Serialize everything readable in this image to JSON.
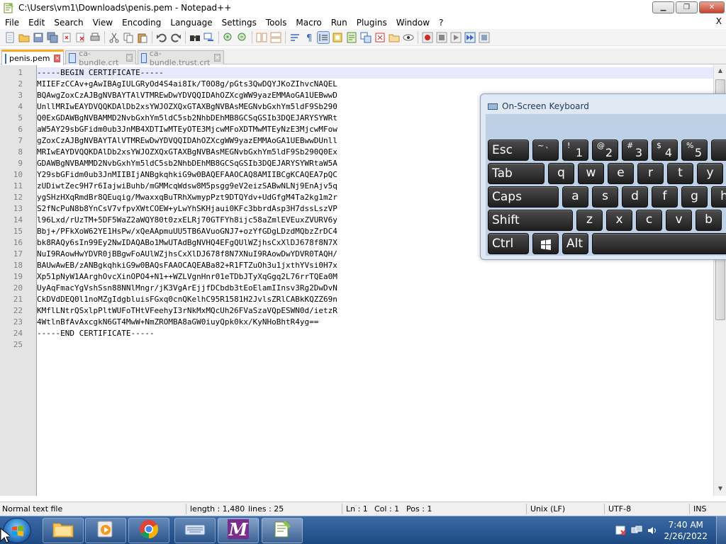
{
  "window": {
    "title": "C:\\Users\\vm1\\Downloads\\penis.pem - Notepad++",
    "minimize_label": "▁",
    "maximize_label": "❐",
    "close_label": "✕"
  },
  "menu": {
    "items": [
      "File",
      "Edit",
      "Search",
      "View",
      "Encoding",
      "Language",
      "Settings",
      "Tools",
      "Macro",
      "Run",
      "Plugins",
      "Window",
      "?"
    ],
    "close": "X"
  },
  "tabs": [
    {
      "label": "penis.pem",
      "active": true
    },
    {
      "label": "ca-bundle.crt",
      "active": false
    },
    {
      "label": "ca-bundle.trust.crt",
      "active": false
    }
  ],
  "editor": {
    "current_line": 1,
    "lines": [
      "-----BEGIN CERTIFICATE-----",
      "MIIEFzCCAv+gAwIBAgIULGRyOd4S4ai8Ik/T0O8g/pGts3QwDQYJKoZIhvcNAQEL",
      "BQAwgZoxCzAJBgNVBAYTAlVTMREwDwYDVQQIDAhOZXcgWW9yazEMMAoGA1UEBwwD",
      "UnllMRIwEAYDVQQKDAlDb2xsYWJOZXQxGTAXBgNVBAsMEGNvbGxhYm5ldF9Sb290",
      "Q0ExGDAWBgNVBAMMD2NvbGxhYm5ldC5sb2NhbDEhMB8GCSqGSIb3DQEJARYSYWRt",
      "aW5AY29sbGFidm0ub3JnMB4XDTIwMTEyOTE3MjcwMFoXDTMwMTEyNzE3MjcwMFow",
      "gZoxCzAJBgNVBAYTAlVTMREwDwYDVQQIDAhOZXcgWW9yazEMMAoGA1UEBwwDUnll",
      "MRIwEAYDVQQKDAlDb2xsYWJOZXQxGTAXBgNVBAsMEGNvbGxhYm5ldF9Sb290Q0Ex",
      "GDAWBgNVBAMMD2NvbGxhYm5ldC5sb2NhbDEhMB8GCSqGSIb3DQEJARYSYWRtaW5A",
      "Y29sbGFidm0ub3JnMIIBIjANBgkqhkiG9w0BAQEFAAOCAQ8AMIIBCgKCAQEA7pQC",
      "zUDiwtZec9H7r6IajwiBuhb/mGMMcqWdsw8M5psgg9eV2eizSABwNLNj9EnAjv5q",
      "ygSHzHXqRmdBr8QEuqig/MwaxxqBuTRhXwmypPzt9DTQYdv+UdGfgM4Ta2kg1m2r",
      "S2fNcPuN8b8YnCsV7vfpvXWtCOEW+yLwYhSKHjaui0KFc3bbrdAsp3H7dssLszVP",
      "l96Lxd/rUzTM+5DF5WaZ2aWQY80t0zxELRj70GTFYh8ijc58aZmlEVEuxZVURV6y",
      "Bbj+/PFkXoW62YE1HsPw/xQeAApmuUU5TB6AVuoGNJ7+ozYfGDgLDzdMQbzZrDC4",
      "bk8RAQy6sIn99Ey2NwIDAQABo1MwUTAdBgNVHQ4EFgQUlWZjhsCxXlDJ678f8N7X",
      "NuI9RAowHwYDVR0jBBgwFoAUlWZjhsCxXlDJ678f8N7XNuI9RAowDwYDVR0TAQH/",
      "BAUwAwEB/zANBgkqhkiG9w0BAQsFAAOCAQEABa82+R1FTZuOh3u1jxthYVsi0H7x",
      "Xp51pNyW1AArghOvcXinOPO4+N1++WZLVgnHnr01eTDbJTyXqGgq2L76rrTQEa0M",
      "UyAqFmacYgVshSsn88NNlMngr/jK3VgArEjjfDCbdb3tEoElamIInsv3Rg2DwDvN",
      "CkDVdDEQ0l1noMZgIdgbluisFGxq0cnQKelhC95R1581H2JvlsZRlCABkKQZZ69n",
      "KMflLNtrQSxlpPltWUFoTHtVFeehyI3rNkMxMQcUh26FVaSzaVQpESWN0d/ietzR",
      "4WtlnBfAvAxcgkN6GT4MwW+NmZROMBA8aGW0iuyQpk0kx/KyNHoBhtR4yg==",
      "-----END CERTIFICATE-----",
      ""
    ]
  },
  "status": {
    "file_type": "Normal text file",
    "length": "length : 1,480",
    "lines": "lines : 25",
    "ln": "Ln : 1",
    "col": "Col : 1",
    "pos": "Pos : 1",
    "eol": "Unix (LF)",
    "encoding": "UTF-8",
    "mode": "INS"
  },
  "osk": {
    "title": "On-Screen Keyboard",
    "keys": {
      "esc": "Esc",
      "tilde_sub": "~",
      "tilde_main": "`",
      "k1_sub": "!",
      "k1": "1",
      "k2_sub": "@",
      "k2": "2",
      "k3_sub": "#",
      "k3": "3",
      "k4_sub": "$",
      "k4": "4",
      "k5_sub": "%",
      "k5": "5",
      "tab": "Tab",
      "q": "q",
      "w": "w",
      "e": "e",
      "r": "r",
      "t": "t",
      "y": "y",
      "caps": "Caps",
      "a": "a",
      "s": "s",
      "d": "d",
      "f": "f",
      "g": "g",
      "h": "h",
      "shift": "Shift",
      "z": "z",
      "x": "x",
      "c": "c",
      "v": "v",
      "b": "b",
      "ctrl": "Ctrl",
      "alt": "Alt"
    }
  },
  "taskbar": {
    "clock_time": "7:40 AM",
    "clock_date": "2/26/2022"
  },
  "colors": {
    "accent_tab": "#f9a825",
    "taskbar": "#2a5a96",
    "current_line": "#e8e8ff"
  }
}
